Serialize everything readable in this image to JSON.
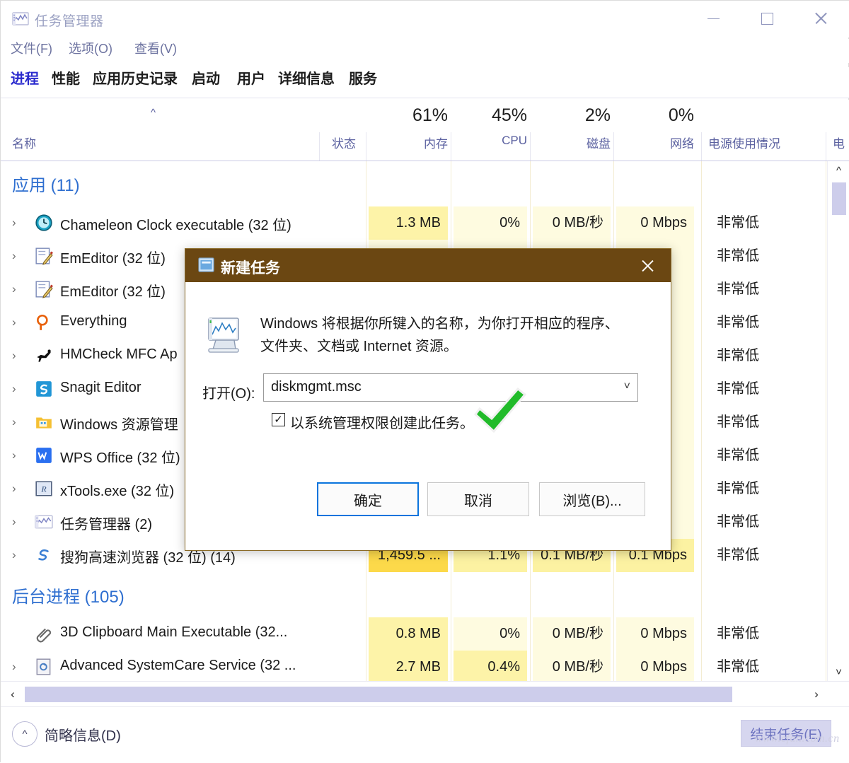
{
  "window": {
    "title": "任务管理器",
    "icon": "task-manager-icon",
    "controls": {
      "minimize": "最小化",
      "maximize": "最大化",
      "close": "关闭"
    }
  },
  "menu": {
    "items": [
      "文件(F)",
      "选项(O)",
      "查看(V)"
    ]
  },
  "tabs": [
    {
      "label": "进程",
      "active": true
    },
    {
      "label": "性能",
      "active": false
    },
    {
      "label": "应用历史记录",
      "active": false
    },
    {
      "label": "启动",
      "active": false
    },
    {
      "label": "用户",
      "active": false
    },
    {
      "label": "详细信息",
      "active": false
    },
    {
      "label": "服务",
      "active": false
    }
  ],
  "columns": [
    {
      "key": "name",
      "label": "名称",
      "pct": ""
    },
    {
      "key": "status",
      "label": "状态",
      "pct": ""
    },
    {
      "key": "memory",
      "label": "内存",
      "pct": "61%"
    },
    {
      "key": "cpu",
      "label": "CPU",
      "pct": "45%"
    },
    {
      "key": "disk",
      "label": "磁盘",
      "pct": "2%"
    },
    {
      "key": "network",
      "label": "网络",
      "pct": "0%"
    },
    {
      "key": "power",
      "label": "电源使用情况",
      "pct": ""
    },
    {
      "key": "power2",
      "label": "电",
      "pct": ""
    }
  ],
  "groups": {
    "apps": "应用 (11)",
    "background": "后台进程 (105)"
  },
  "rows": [
    {
      "name": "Chameleon Clock executable (32 位)",
      "icon": "clock-icon",
      "memory": "1.3 MB",
      "cpu": "0%",
      "disk": "0 MB/秒",
      "network": "0 Mbps",
      "power": "非常低",
      "expandable": true
    },
    {
      "name": "EmEditor (32 位)",
      "icon": "emeditor-icon",
      "memory": "",
      "cpu": "",
      "disk": "",
      "network": "",
      "power": "非常低",
      "expandable": true
    },
    {
      "name": "EmEditor (32 位)",
      "icon": "emeditor-icon",
      "memory": "",
      "cpu": "",
      "disk": "",
      "network": "",
      "power": "非常低",
      "expandable": true
    },
    {
      "name": "Everything",
      "icon": "everything-icon",
      "memory": "",
      "cpu": "",
      "disk": "",
      "network": "",
      "power": "非常低",
      "expandable": true
    },
    {
      "name": "HMCheck MFC Ap",
      "icon": "hmcheck-icon",
      "memory": "",
      "cpu": "",
      "disk": "",
      "network": "",
      "power": "非常低",
      "expandable": true
    },
    {
      "name": "Snagit Editor",
      "icon": "snagit-icon",
      "memory": "",
      "cpu": "",
      "disk": "",
      "network": "",
      "power": "非常低",
      "expandable": true
    },
    {
      "name": "Windows 资源管理",
      "icon": "explorer-icon",
      "memory": "",
      "cpu": "",
      "disk": "",
      "network": "",
      "power": "非常低",
      "expandable": true
    },
    {
      "name": "WPS Office (32 位)",
      "icon": "wps-icon",
      "memory": "",
      "cpu": "",
      "disk": "",
      "network": "",
      "power": "非常低",
      "expandable": true
    },
    {
      "name": "xTools.exe (32 位)",
      "icon": "xtools-icon",
      "memory": "",
      "cpu": "",
      "disk": "",
      "network": "",
      "power": "非常低",
      "expandable": true
    },
    {
      "name": "任务管理器 (2)",
      "icon": "task-manager-icon",
      "memory": "",
      "cpu": "",
      "disk": "",
      "network": "",
      "power": "非常低",
      "expandable": true
    },
    {
      "name": "搜狗高速浏览器 (32 位) (14)",
      "icon": "sogou-icon",
      "memory": "1,459.5 ...",
      "cpu": "1.1%",
      "disk": "0.1 MB/秒",
      "network": "0.1 Mbps",
      "power": "非常低",
      "expandable": true
    }
  ],
  "bg_rows": [
    {
      "name": "3D Clipboard Main Executable (32...",
      "icon": "clip-icon",
      "memory": "0.8 MB",
      "cpu": "0%",
      "disk": "0 MB/秒",
      "network": "0 Mbps",
      "power": "非常低",
      "expandable": false
    },
    {
      "name": "Advanced SystemCare Service (32 ...",
      "icon": "service-icon",
      "memory": "2.7 MB",
      "cpu": "0.4%",
      "disk": "0 MB/秒",
      "network": "0 Mbps",
      "power": "非常低",
      "expandable": true
    }
  ],
  "statusbar": {
    "fewer_details": "简略信息(D)",
    "end_task": "结束任务(E)",
    "collapse_icon": "chevron-up-icon"
  },
  "watermark": "www.cfan.com.cn",
  "dialog": {
    "title": "新建任务",
    "icon": "new-task-icon",
    "close": "关闭",
    "description_line1": "Windows 将根据你所键入的名称，为你打开相应的程序、",
    "description_line2": "文件夹、文档或 Internet 资源。",
    "open_label": "打开(O):",
    "open_value": "diskmgmt.msc",
    "open_placeholder": "",
    "checkbox_label": "以系统管理权限创建此任务。",
    "checkbox_checked": true,
    "checkbox_glyph": "✓",
    "buttons": {
      "ok": "确定",
      "cancel": "取消",
      "browse": "浏览(B)..."
    },
    "titlebar_color": "#6b4712",
    "annotation": "green-check-mark"
  },
  "scrollbars": {
    "vertical_up": "▲",
    "vertical_down": "▼",
    "horizontal_left": "‹",
    "horizontal_right": "›"
  }
}
